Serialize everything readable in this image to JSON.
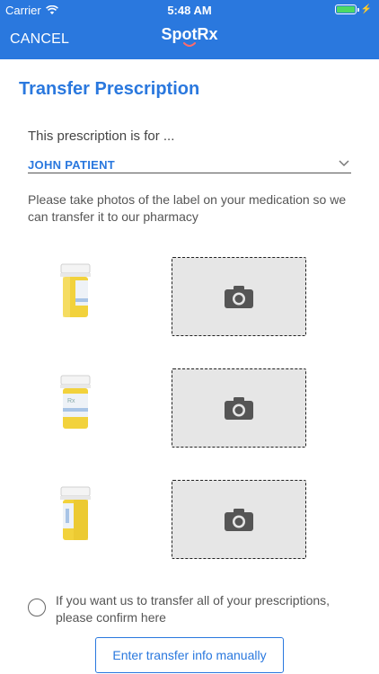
{
  "status_bar": {
    "carrier": "Carrier",
    "time": "5:48 AM"
  },
  "nav": {
    "cancel_label": "CANCEL",
    "logo_text": "Spot",
    "logo_accent": "Rx"
  },
  "title": "Transfer Prescription",
  "patient": {
    "prompt": "This prescription is for ...",
    "selected": "JOHN PATIENT"
  },
  "instructions": "Please take photos of the label on your medication so we can transfer it to our pharmacy",
  "photo_slots": [
    {
      "icon": "camera-icon"
    },
    {
      "icon": "camera-icon"
    },
    {
      "icon": "camera-icon"
    }
  ],
  "confirm": {
    "text": "If you want us to transfer all of your prescriptions, please confirm here",
    "checked": false
  },
  "manual_button": "Enter transfer info manually",
  "colors": {
    "brand_blue": "#2a78de",
    "bottle_yellow": "#f2d23c",
    "slot_gray": "#e6e6e6"
  }
}
